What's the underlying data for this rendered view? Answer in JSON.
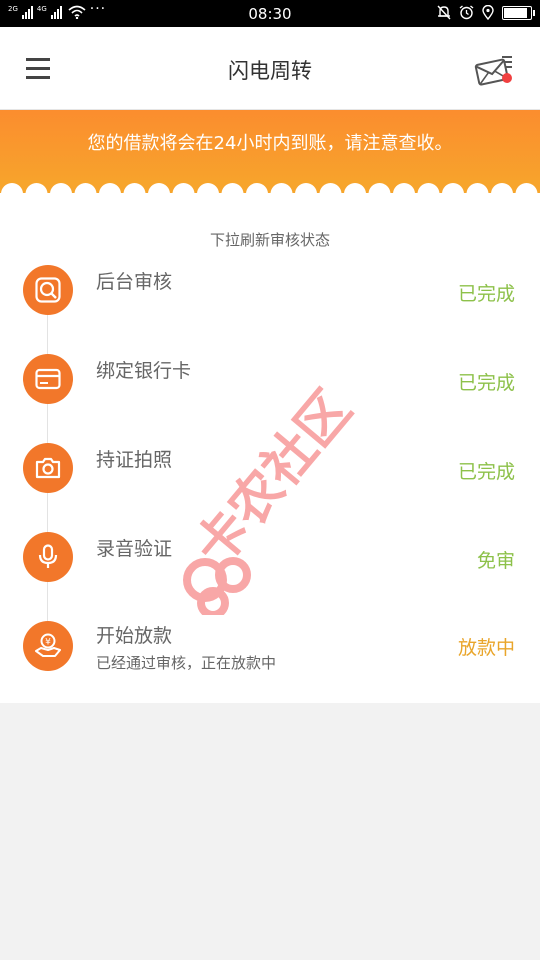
{
  "status_bar": {
    "network_1": "2G",
    "network_2": "4G",
    "more": "···",
    "time": "08:30"
  },
  "header": {
    "title": "闪电周转"
  },
  "banner": {
    "text": "您的借款将会在24小时内到账，请注意查收。"
  },
  "progress": {
    "hint": "下拉刷新审核状态",
    "steps": [
      {
        "icon": "search-icon",
        "title": "后台审核",
        "status": "已完成"
      },
      {
        "icon": "bank-card-icon",
        "title": "绑定银行卡",
        "status": "已完成"
      },
      {
        "icon": "camera-icon",
        "title": "持证拍照",
        "status": "已完成"
      },
      {
        "icon": "microphone-icon",
        "title": "录音验证",
        "status": "免审"
      },
      {
        "icon": "yuan-hand-icon",
        "title": "开始放款",
        "subtitle": "已经通过审核，正在放款中",
        "status": "放款中"
      }
    ]
  },
  "watermark": {
    "text": "卡农社区"
  },
  "colors": {
    "accent": "#f2772a",
    "banner_top": "#fb8d2e",
    "done": "#8dc14a",
    "pending": "#e9a52a",
    "notification_dot": "#f04040"
  }
}
